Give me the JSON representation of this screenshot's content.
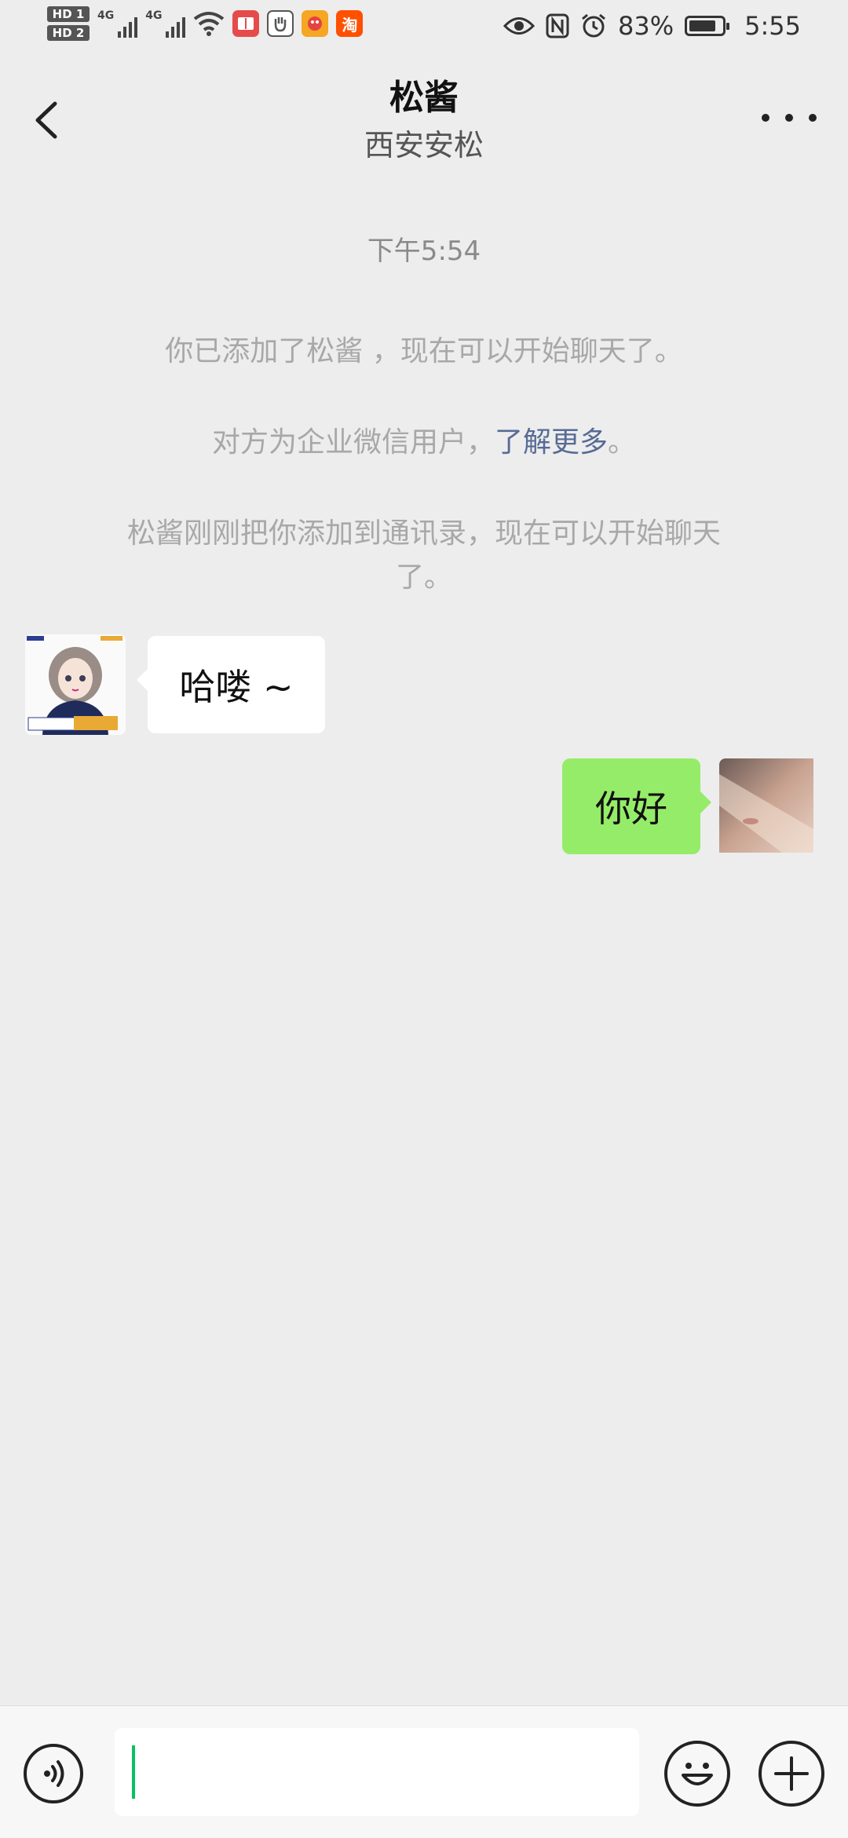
{
  "status_bar": {
    "hd1": "HD 1",
    "hd2": "HD 2",
    "net1": "4G",
    "net2": "4G",
    "taobao": "淘",
    "battery_percent": "83%",
    "battery_level": 0.83,
    "time": "5:55"
  },
  "header": {
    "title": "松酱",
    "subtitle": "西安安松"
  },
  "chat": {
    "timestamp": "下午5:54",
    "system_messages": {
      "added": "你已添加了松酱 ，现在可以开始聊天了。",
      "enterprise_prefix": "对方为企业微信用户，",
      "enterprise_link": "了解更多",
      "enterprise_suffix": "。",
      "contact_added": "松酱刚刚把你添加到通讯录，现在可以开始聊天了。"
    },
    "messages": [
      {
        "side": "left",
        "text": "哈喽 ~"
      },
      {
        "side": "right",
        "text": "你好"
      }
    ]
  },
  "colors": {
    "background": "#ededed",
    "self_bubble": "#95ec69",
    "link": "#576b95",
    "caret": "#07c160"
  },
  "icons": {
    "back": "back-arrow-icon",
    "more": "more-dots-icon",
    "voice": "voice-icon",
    "emoji": "emoji-icon",
    "plus": "plus-icon"
  }
}
